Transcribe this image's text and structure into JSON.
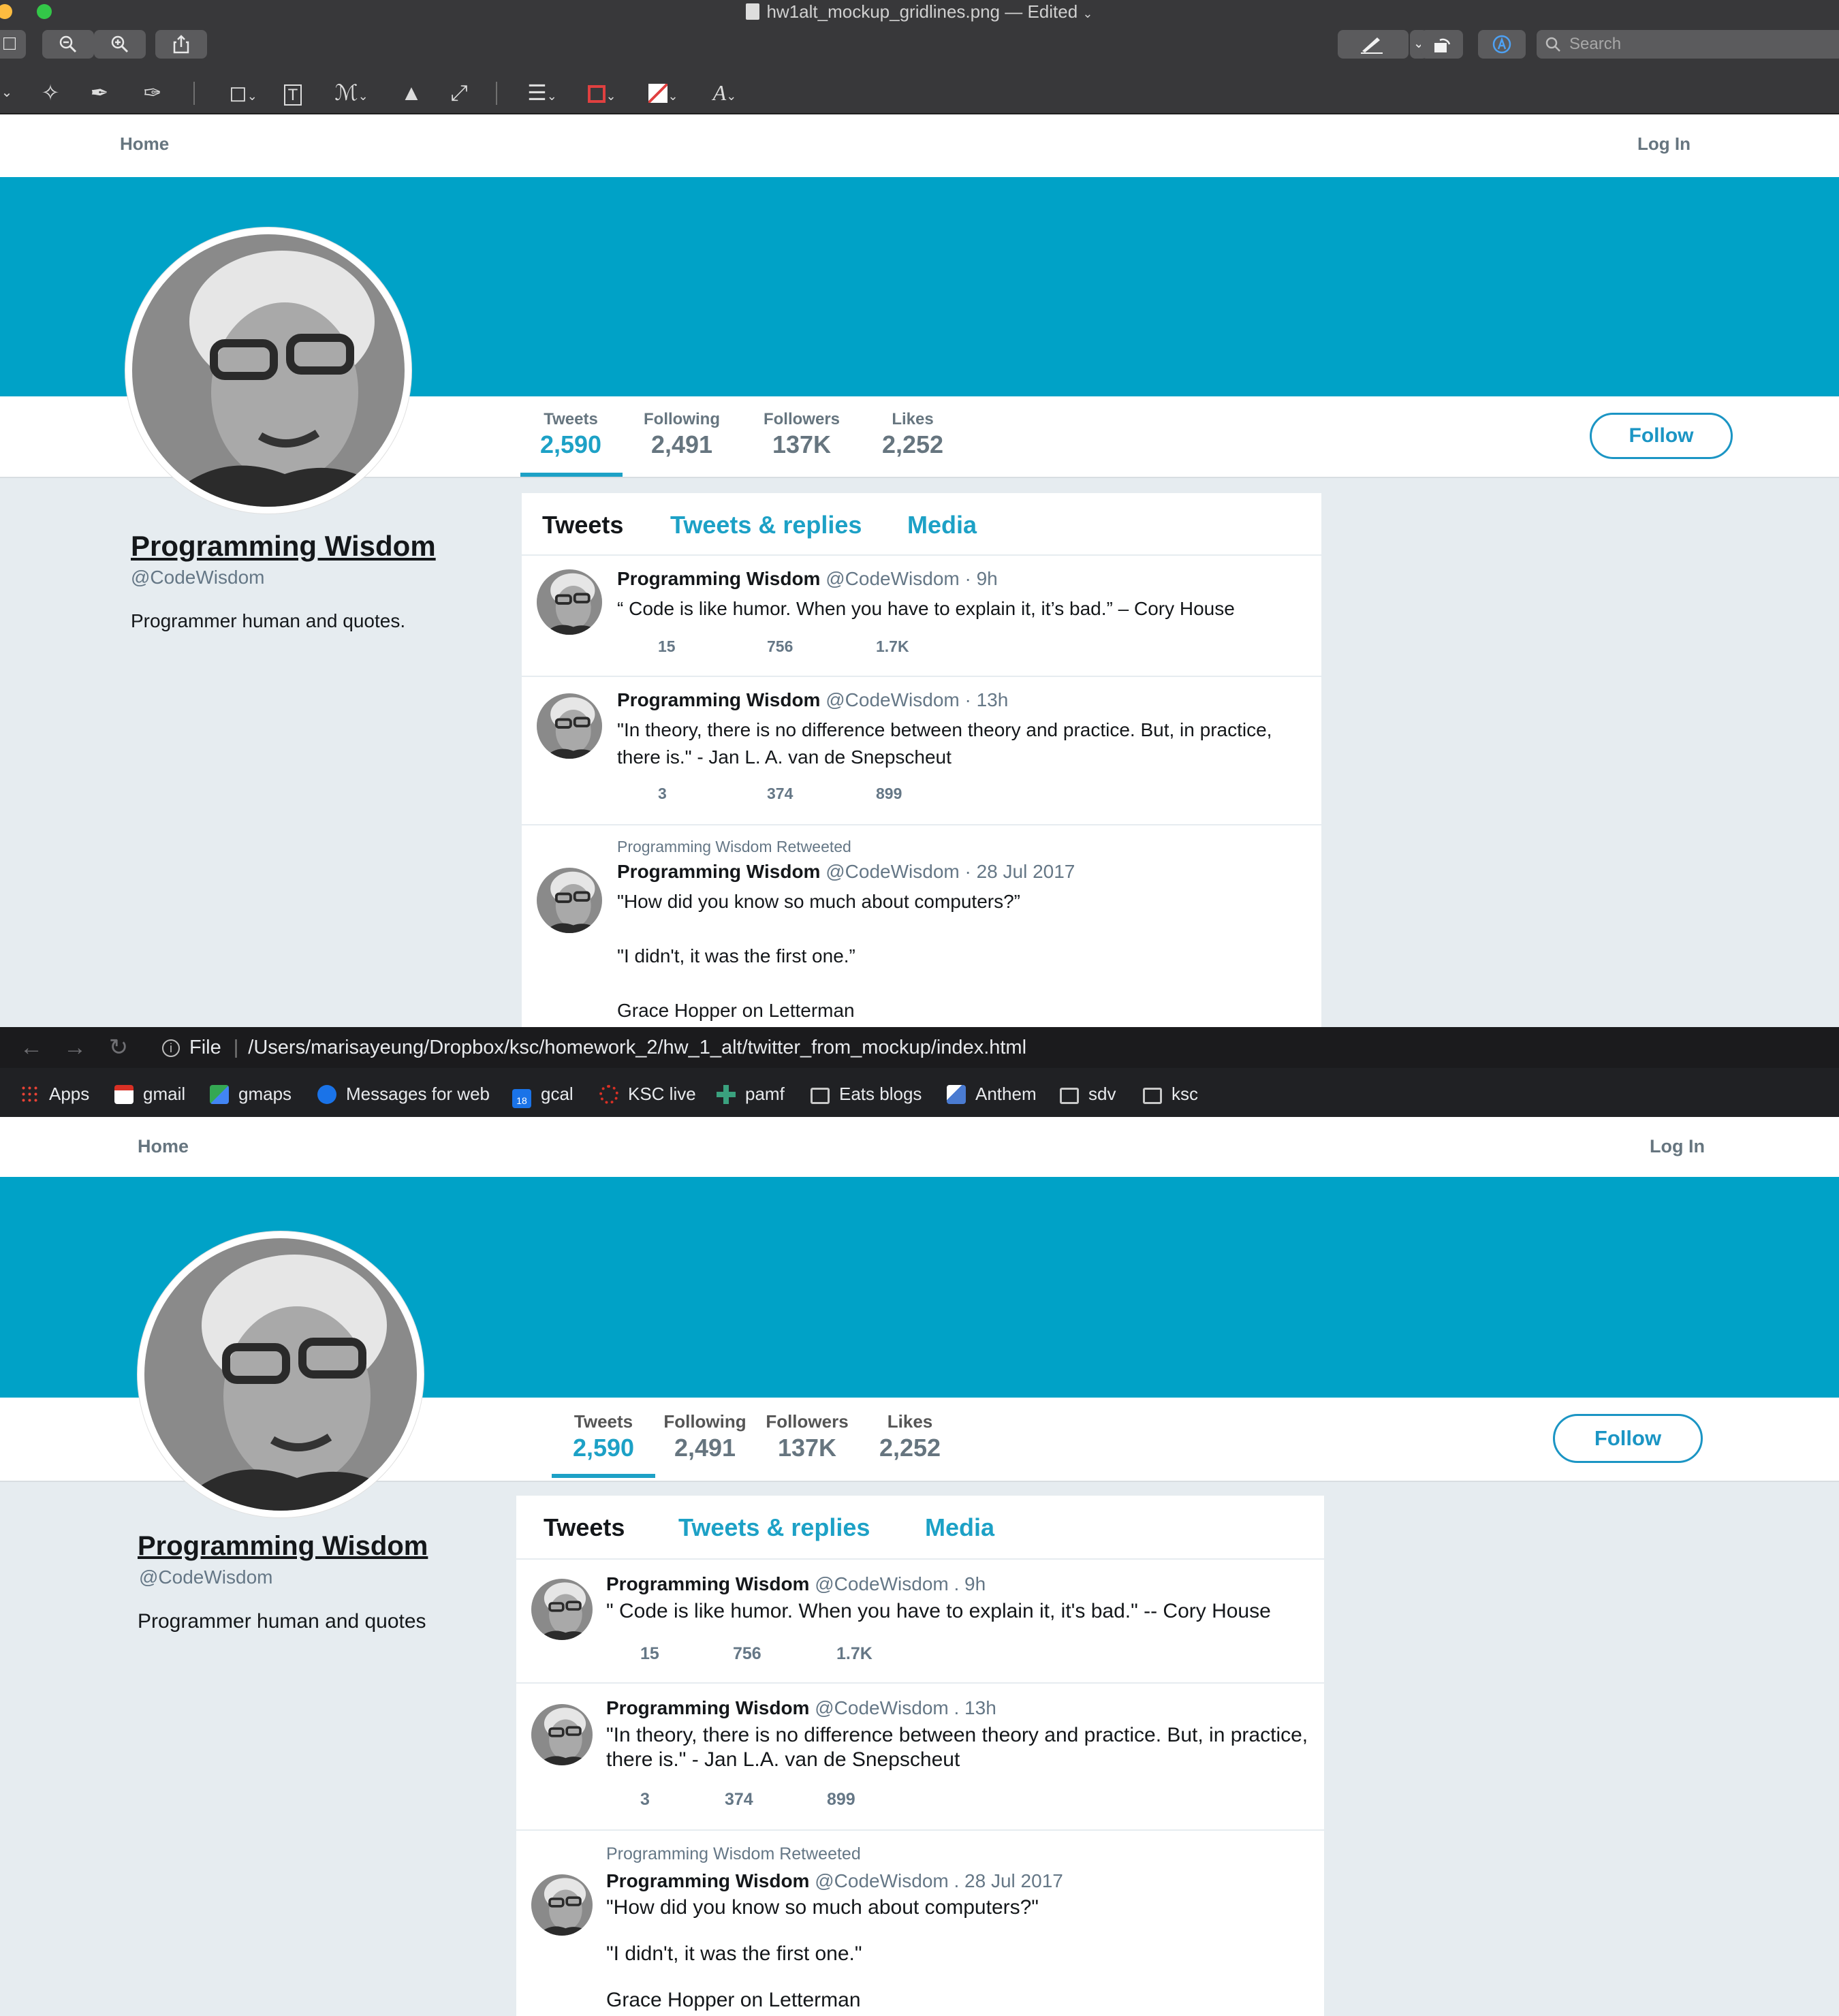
{
  "preview_window": {
    "title": "hw1alt_mockup_gridlines.png — Edited",
    "search_placeholder": "Search",
    "traffic_colors": [
      "#fdbc40",
      "#33c748"
    ]
  },
  "browser": {
    "file_label": "File",
    "url": "/Users/marisayeung/Dropbox/ksc/homework_2/hw_1_alt/twitter_from_mockup/index.html",
    "bookmarks": [
      {
        "label": "Apps",
        "icon": "apps-grid-icon"
      },
      {
        "label": "gmail",
        "icon": "gmail-icon"
      },
      {
        "label": "gmaps",
        "icon": "maps-icon"
      },
      {
        "label": "Messages for web",
        "icon": "messages-icon"
      },
      {
        "label": "gcal",
        "icon": "calendar-icon",
        "icon_text": "18"
      },
      {
        "label": "KSC live",
        "icon": "ksc-icon"
      },
      {
        "label": "pamf",
        "icon": "pamf-icon"
      },
      {
        "label": "Eats blogs",
        "icon": "folder-icon"
      },
      {
        "label": "Anthem",
        "icon": "anthem-icon"
      },
      {
        "label": "sdv",
        "icon": "folder-icon"
      },
      {
        "label": "ksc",
        "icon": "folder-icon"
      }
    ]
  },
  "mockup": {
    "nav": {
      "home": "Home",
      "login": "Log In"
    },
    "stats": [
      {
        "label": "Tweets",
        "value": "2,590"
      },
      {
        "label": "Following",
        "value": "2,491"
      },
      {
        "label": "Followers",
        "value": "137K"
      },
      {
        "label": "Likes",
        "value": "2,252"
      }
    ],
    "follow": "Follow",
    "profile": {
      "name": "Programming Wisdom",
      "handle": "@CodeWisdom",
      "bio": "Programmer human and quotes."
    },
    "tabs": [
      "Tweets",
      "Tweets & replies",
      "Media"
    ],
    "tweets": [
      {
        "name": "Programming Wisdom",
        "meta": "@CodeWisdom · 9h",
        "text": "“ Code is like humor. When you have to explain it, it’s bad.” – Cory House",
        "actions": [
          "15",
          "756",
          "1.7K"
        ]
      },
      {
        "name": "Programming Wisdom",
        "meta": "@CodeWisdom · 13h",
        "text": "\"In theory, there is no difference between theory and practice. But, in practice,\nthere is.\" - Jan L. A. van de Snepscheut",
        "actions": [
          "3",
          "374",
          "899"
        ]
      },
      {
        "context": "Programming Wisdom Retweeted",
        "name": "Programming Wisdom",
        "meta": "@CodeWisdom · 28 Jul 2017",
        "text": "\"How did you know so much about computers?”\n\n\"I didn't, it was the first one.”\n\nGrace Hopper on Letterman"
      }
    ]
  },
  "implementation": {
    "nav": {
      "home": "Home",
      "login": "Log In"
    },
    "stats": [
      {
        "label": "Tweets",
        "value": "2,590"
      },
      {
        "label": "Following",
        "value": "2,491"
      },
      {
        "label": "Followers",
        "value": "137K"
      },
      {
        "label": "Likes",
        "value": "2,252"
      }
    ],
    "follow": "Follow",
    "profile": {
      "name": "Programming Wisdom",
      "handle": "@CodeWisdom",
      "bio": "Programmer human and quotes"
    },
    "tabs": [
      "Tweets",
      "Tweets & replies",
      "Media"
    ],
    "tweets": [
      {
        "name": "Programming Wisdom",
        "meta": "@CodeWisdom . 9h",
        "text": "\" Code is like humor. When you have to explain it, it's bad.\" -- Cory House",
        "actions": [
          "15",
          "756",
          "1.7K"
        ]
      },
      {
        "name": "Programming Wisdom",
        "meta": "@CodeWisdom . 13h",
        "text": "\"In theory, there is no difference between theory and practice. But, in practice,\nthere is.\" - Jan L.A. van de Snepscheut",
        "actions": [
          "3",
          "374",
          "899"
        ]
      },
      {
        "context": "Programming Wisdom Retweeted",
        "name": "Programming Wisdom",
        "meta": "@CodeWisdom . 28 Jul 2017",
        "text": "\"How did you know so much about computers?\"\n\n\"I didn't, it was the first one.\"\n\nGrace Hopper on Letterman"
      }
    ]
  },
  "colors": {
    "banner": "#00a2c7",
    "accent": "#1da1c6",
    "page_bg": "#e6ecf0"
  }
}
